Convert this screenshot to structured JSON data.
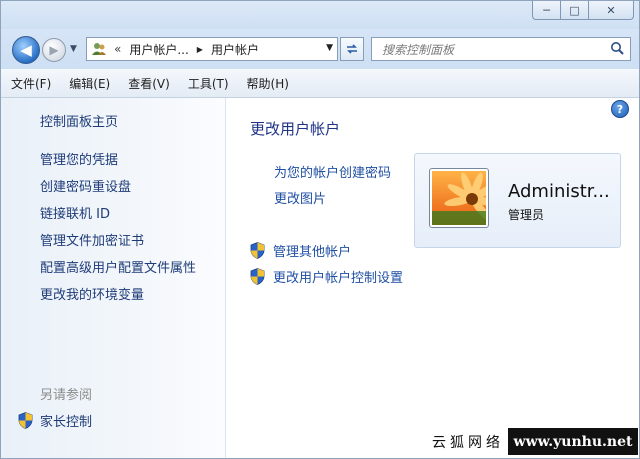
{
  "window": {
    "caption_min": "─",
    "caption_max": "□",
    "caption_close": "✕"
  },
  "address": {
    "chevron": "«",
    "crumbs": [
      "用户帐户...",
      "用户帐户"
    ],
    "separator": "▶",
    "dropdown": "▼"
  },
  "search": {
    "placeholder": "搜索控制面板"
  },
  "menu": [
    "文件(F)",
    "编辑(E)",
    "查看(V)",
    "工具(T)",
    "帮助(H)"
  ],
  "sidebar": {
    "home": "控制面板主页",
    "links": [
      "管理您的凭据",
      "创建密码重设盘",
      "链接联机 ID",
      "管理文件加密证书",
      "配置高级用户配置文件属性",
      "更改我的环境变量"
    ],
    "see_also": "另请参阅",
    "parental_controls": "家长控制"
  },
  "main": {
    "title": "更改用户帐户",
    "tasks": [
      "为您的帐户创建密码",
      "更改图片"
    ],
    "shield_tasks": [
      "管理其他帐户",
      "更改用户帐户控制设置"
    ],
    "help": "?"
  },
  "user": {
    "name": "Administr...",
    "role": "管理员"
  },
  "watermark": {
    "cn": "云狐网络",
    "url": "www.yunhu.net"
  },
  "colors": {
    "link": "#1e4ea3",
    "title": "#1e3287",
    "shield_blue": "#2a63c7",
    "shield_yellow": "#f2c230"
  }
}
